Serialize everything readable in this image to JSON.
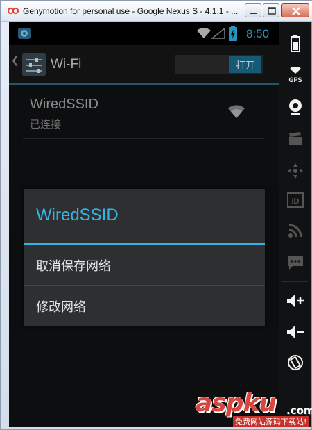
{
  "window": {
    "title": "Genymotion for personal use - Google Nexus S - 4.1.1 - ...",
    "icon": "genymotion-logo-icon",
    "buttons": [
      "minimize-icon",
      "maximize-icon",
      "close-icon"
    ]
  },
  "status_bar": {
    "time": "8:50",
    "time_color": "#33b5e5",
    "icons": [
      "app-notification-icon",
      "wifi-icon",
      "signal-icon",
      "battery-charging-icon"
    ]
  },
  "action_bar": {
    "title": "Wi-Fi",
    "icon": "settings-sliders-icon",
    "toggle_label": "打开"
  },
  "network": {
    "ssid": "WiredSSID",
    "status": "已连接"
  },
  "dialog": {
    "title": "WiredSSID",
    "items": [
      "取消保存网络",
      "修改网络"
    ],
    "accent": "#33b5e5"
  },
  "control_strip": {
    "icons": [
      "battery-icon",
      "gps-icon",
      "webcam-icon",
      "clapperboard-icon",
      "dpad-icon",
      "id-icon",
      "rss-icon",
      "sms-icon",
      "volume-up-icon",
      "volume-down-icon",
      "rotate-icon"
    ],
    "gps_label": "GPS",
    "id_label": "ID"
  },
  "watermark": {
    "main": "aspku",
    "domain": ".com",
    "tagline": "免费网站源码下载站!"
  }
}
